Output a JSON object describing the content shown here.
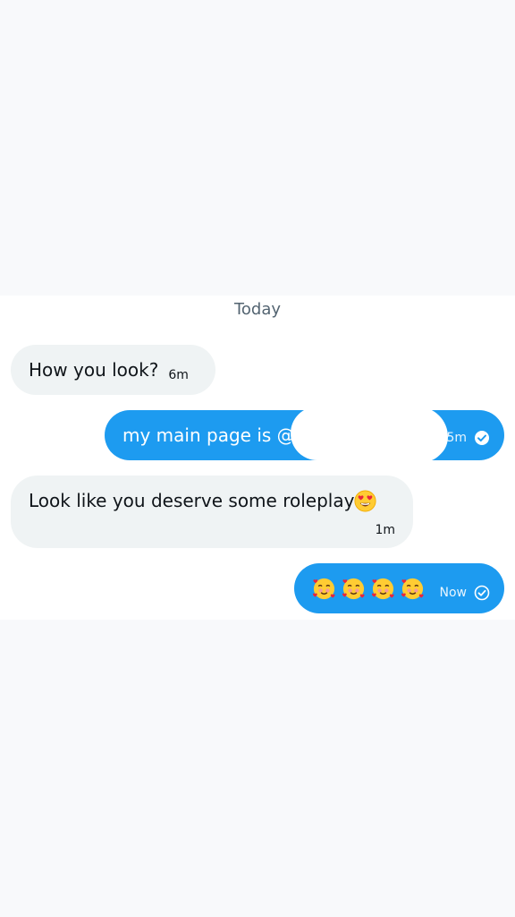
{
  "date_divider": "Today",
  "messages": [
    {
      "direction": "in",
      "text": "How you look?",
      "time": "6m"
    },
    {
      "direction": "out",
      "text": "my main page is @",
      "time": "5m",
      "status_icon": "sent-check-icon"
    },
    {
      "direction": "in",
      "text": "Look like you deserve some roleplay",
      "emoji": "smiling-face-with-heart-eyes",
      "time": "1m"
    },
    {
      "direction": "out",
      "emojis": [
        "smiling-face-with-hearts",
        "smiling-face-with-hearts",
        "smiling-face-with-hearts",
        "smiling-face-with-hearts"
      ],
      "time": "Now",
      "status_icon": "sent-check-icon"
    }
  ],
  "colors": {
    "outgoing_bubble": "#1d9bf0",
    "incoming_bubble": "#eff3f4",
    "background": "#f8f9fb",
    "panel": "#ffffff",
    "divider_text": "#536471"
  }
}
